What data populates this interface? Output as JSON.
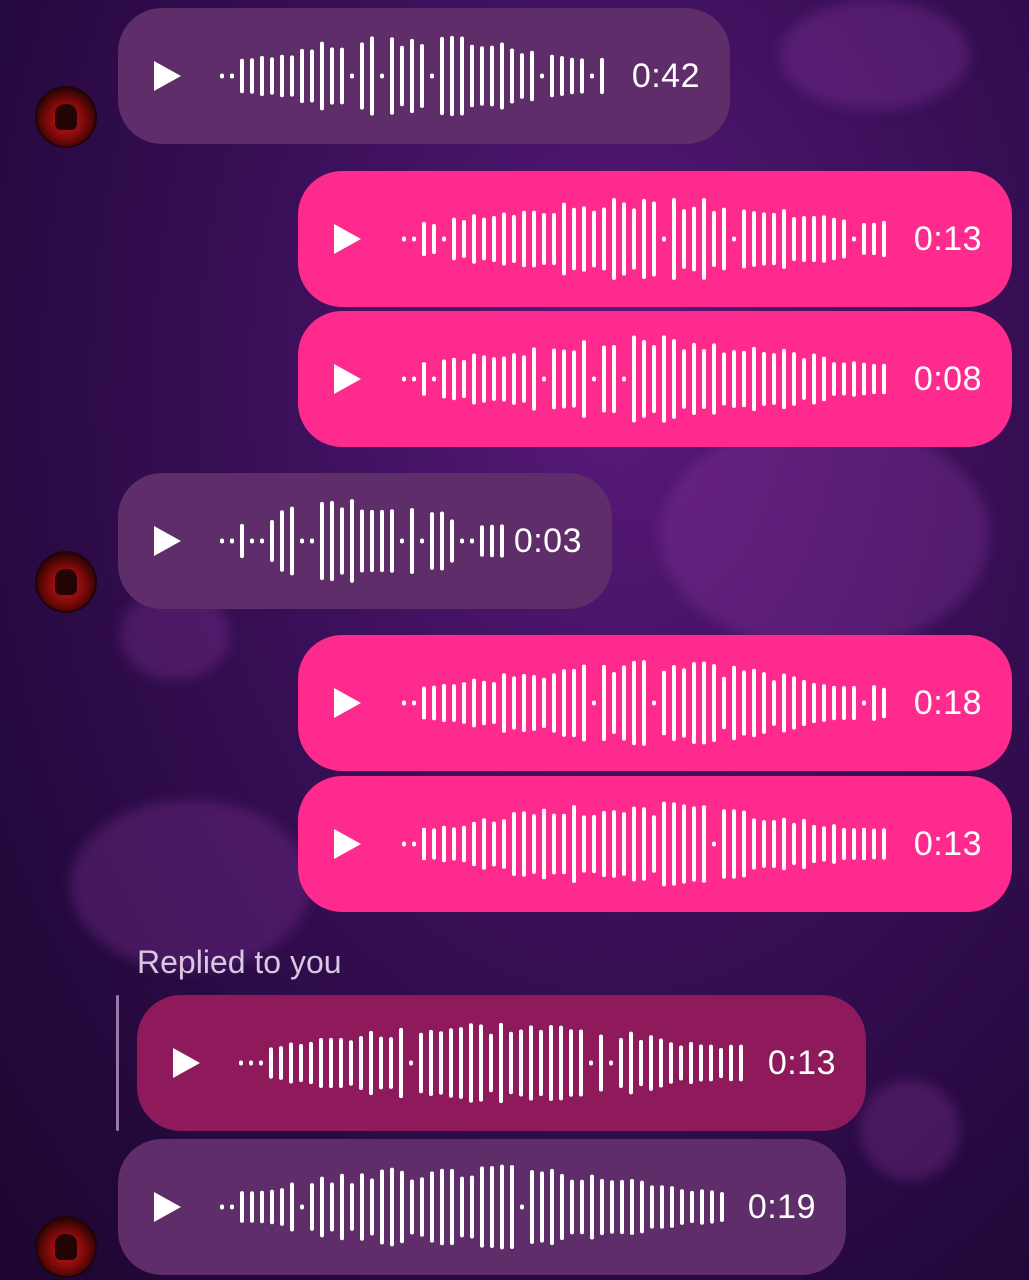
{
  "reply_label": "Replied to you",
  "messages": [
    {
      "side": "incoming",
      "duration": "0:42"
    },
    {
      "side": "outgoing",
      "duration": "0:13"
    },
    {
      "side": "outgoing",
      "duration": "0:08"
    },
    {
      "side": "incoming",
      "duration": "0:03"
    },
    {
      "side": "outgoing",
      "duration": "0:18"
    },
    {
      "side": "outgoing",
      "duration": "0:13"
    },
    {
      "side": "replied",
      "duration": "0:13"
    },
    {
      "side": "incoming",
      "duration": "0:19"
    }
  ],
  "icons": {
    "play": "play-icon",
    "avatar": "contact-avatar"
  },
  "colors": {
    "incoming": "#5e2d6a",
    "outgoing": "#ff2a8e",
    "replied": "#8e1a5c",
    "background": "#3a0f58"
  }
}
